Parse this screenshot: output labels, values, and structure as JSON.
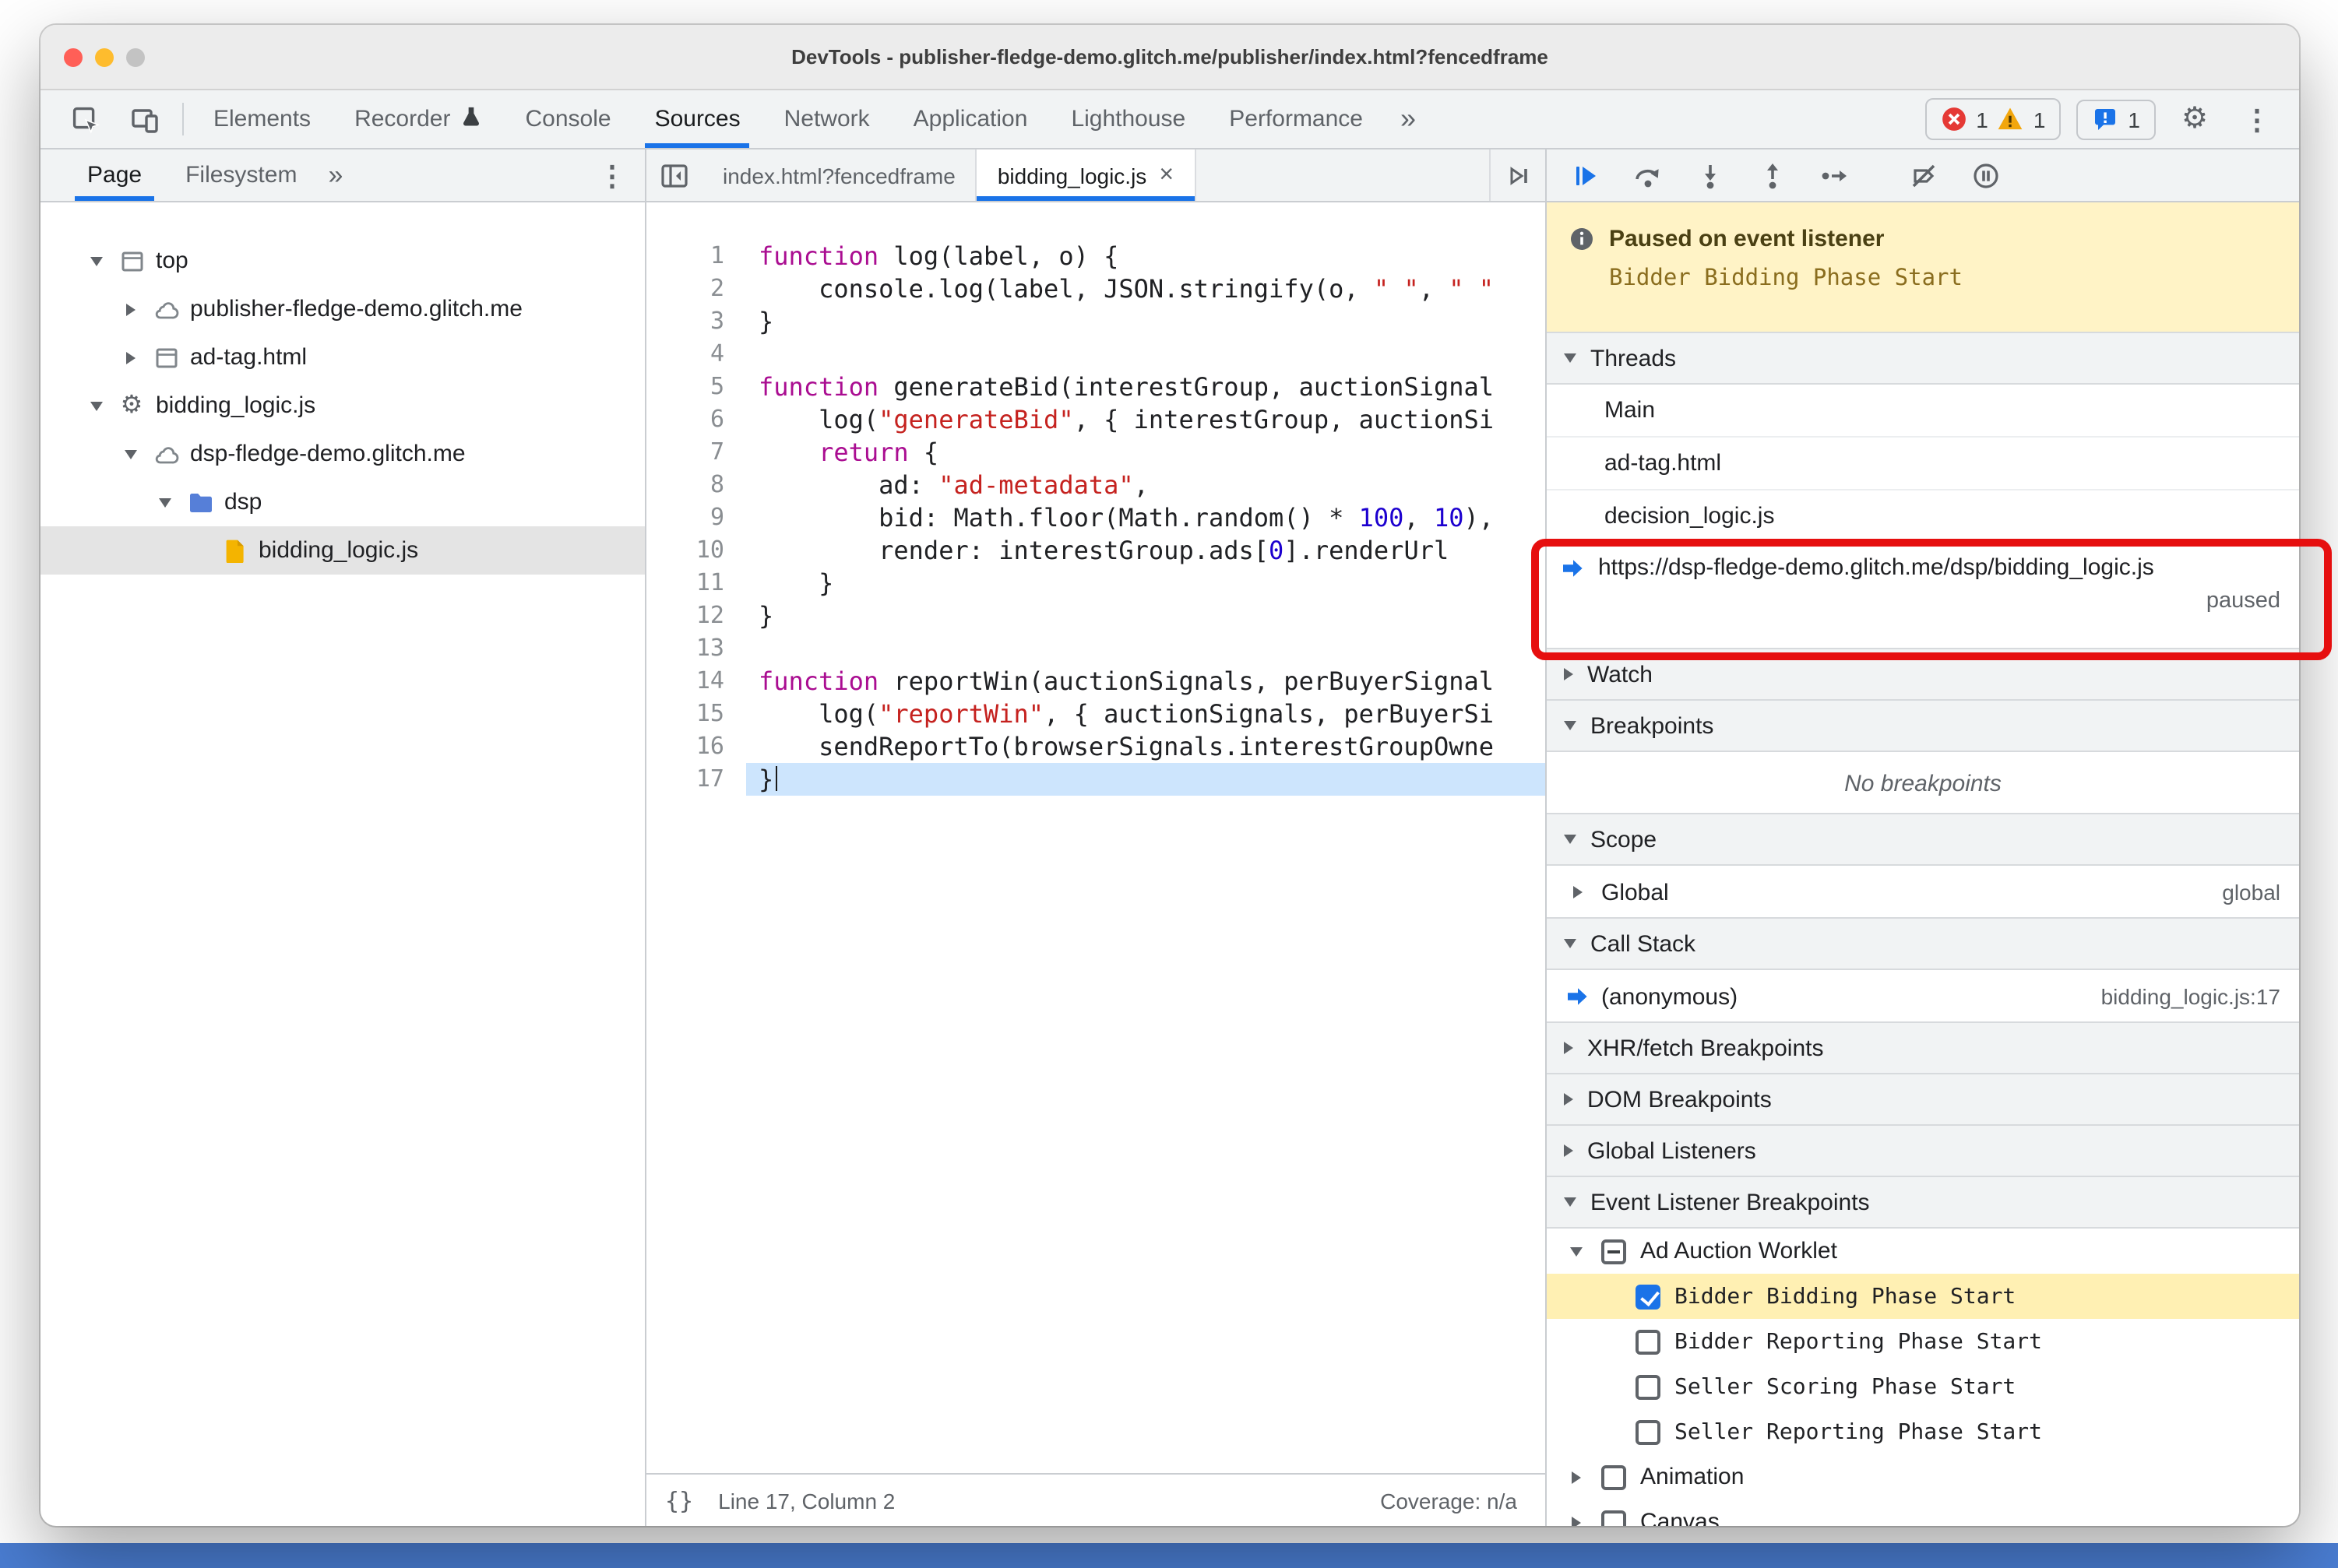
{
  "window": {
    "title": "DevTools - publisher-fledge-demo.glitch.me/publisher/index.html?fencedframe"
  },
  "toolbar": {
    "tabs": [
      {
        "label": "Elements"
      },
      {
        "label": "Recorder",
        "badge_icon": "flask"
      },
      {
        "label": "Console"
      },
      {
        "label": "Sources",
        "active": true
      },
      {
        "label": "Network"
      },
      {
        "label": "Application"
      },
      {
        "label": "Lighthouse"
      },
      {
        "label": "Performance"
      }
    ],
    "more_label": "»",
    "error_count": "1",
    "warning_count": "1",
    "issues_count": "1"
  },
  "sidebar": {
    "tabs": [
      {
        "label": "Page",
        "active": true
      },
      {
        "label": "Filesystem"
      }
    ],
    "more_label": "»",
    "tree": [
      {
        "label": "top",
        "icon": "frame-icon",
        "expander": "open",
        "indent": 0
      },
      {
        "label": "publisher-fledge-demo.glitch.me",
        "icon": "cloud-icon",
        "expander": "closed",
        "indent": 1
      },
      {
        "label": "ad-tag.html",
        "icon": "frame-icon",
        "expander": "closed",
        "indent": 1
      },
      {
        "label": "bidding_logic.js",
        "icon": "gear-icon",
        "expander": "open",
        "indent": 0
      },
      {
        "label": "dsp-fledge-demo.glitch.me",
        "icon": "cloud-icon",
        "expander": "open",
        "indent": 1
      },
      {
        "label": "dsp",
        "icon": "folder-icon",
        "expander": "open",
        "indent": 2
      },
      {
        "label": "bidding_logic.js",
        "icon": "js-file-icon",
        "expander": "none",
        "indent": 3,
        "selected": true
      }
    ]
  },
  "editor": {
    "tabs": [
      {
        "label": "index.html?fencedframe"
      },
      {
        "label": "bidding_logic.js",
        "active": true,
        "closable": true
      }
    ],
    "lines": [
      {
        "n": 1,
        "tokens": [
          [
            "kw",
            "function"
          ],
          [
            "pl",
            " log(label, o) {"
          ]
        ]
      },
      {
        "n": 2,
        "tokens": [
          [
            "pl",
            "    console.log(label, JSON.stringify(o, "
          ],
          [
            "str",
            "\" \""
          ],
          [
            "pl",
            ", "
          ],
          [
            "str",
            "\" \""
          ]
        ]
      },
      {
        "n": 3,
        "tokens": [
          [
            "pl",
            "}"
          ]
        ]
      },
      {
        "n": 4,
        "tokens": []
      },
      {
        "n": 5,
        "tokens": [
          [
            "kw",
            "function"
          ],
          [
            "pl",
            " generateBid(interestGroup, auctionSignal"
          ]
        ]
      },
      {
        "n": 6,
        "tokens": [
          [
            "pl",
            "    log("
          ],
          [
            "str",
            "\"generateBid\""
          ],
          [
            "pl",
            ", { interestGroup, auctionSi"
          ]
        ]
      },
      {
        "n": 7,
        "tokens": [
          [
            "pl",
            "    "
          ],
          [
            "kw",
            "return"
          ],
          [
            "pl",
            " {"
          ]
        ]
      },
      {
        "n": 8,
        "tokens": [
          [
            "pl",
            "        ad: "
          ],
          [
            "str",
            "\"ad-metadata\""
          ],
          [
            "pl",
            ","
          ]
        ]
      },
      {
        "n": 9,
        "tokens": [
          [
            "pl",
            "        bid: Math.floor(Math.random() * "
          ],
          [
            "num",
            "100"
          ],
          [
            "pl",
            ", "
          ],
          [
            "num",
            "10"
          ],
          [
            "pl",
            "),"
          ]
        ]
      },
      {
        "n": 10,
        "tokens": [
          [
            "pl",
            "        render: interestGroup.ads["
          ],
          [
            "num",
            "0"
          ],
          [
            "pl",
            "].renderUrl"
          ]
        ]
      },
      {
        "n": 11,
        "tokens": [
          [
            "pl",
            "    }"
          ]
        ]
      },
      {
        "n": 12,
        "tokens": [
          [
            "pl",
            "}"
          ]
        ]
      },
      {
        "n": 13,
        "tokens": []
      },
      {
        "n": 14,
        "tokens": [
          [
            "kw",
            "function"
          ],
          [
            "pl",
            " reportWin(auctionSignals, perBuyerSignal"
          ]
        ]
      },
      {
        "n": 15,
        "tokens": [
          [
            "pl",
            "    log("
          ],
          [
            "str",
            "\"reportWin\""
          ],
          [
            "pl",
            ", { auctionSignals, perBuyerSi"
          ]
        ]
      },
      {
        "n": 16,
        "tokens": [
          [
            "pl",
            "    sendReportTo(browserSignals.interestGroupOwne"
          ]
        ]
      },
      {
        "n": 17,
        "tokens": [
          [
            "pl",
            "}"
          ]
        ],
        "exec": true
      }
    ],
    "status": {
      "format_label": "{}",
      "line_col": "Line 17, Column 2",
      "coverage": "Coverage: n/a"
    }
  },
  "debugger": {
    "paused_message": {
      "title": "Paused on event listener",
      "detail": "Bidder Bidding Phase Start"
    },
    "sections": {
      "threads": {
        "title": "Threads",
        "items": [
          {
            "label": "Main"
          },
          {
            "label": "ad-tag.html"
          },
          {
            "label": "decision_logic.js"
          },
          {
            "label": "https://dsp-fledge-demo.glitch.me/dsp/bidding_logic.js",
            "active": true,
            "status": "paused"
          }
        ]
      },
      "watch": {
        "title": "Watch"
      },
      "breakpoints": {
        "title": "Breakpoints",
        "empty_message": "No breakpoints"
      },
      "scope": {
        "title": "Scope",
        "rows": [
          {
            "label": "Global",
            "detail": "global"
          }
        ]
      },
      "call_stack": {
        "title": "Call Stack",
        "frames": [
          {
            "label": "(anonymous)",
            "location": "bidding_logic.js:17"
          }
        ]
      },
      "xhr_breakpoints": {
        "title": "XHR/fetch Breakpoints"
      },
      "dom_breakpoints": {
        "title": "DOM Breakpoints"
      },
      "global_listeners": {
        "title": "Global Listeners"
      },
      "event_listener_breakpoints": {
        "title": "Event Listener Breakpoints",
        "groups": [
          {
            "label": "Ad Auction Worklet",
            "checkbox": "indeterminate",
            "expanded": true,
            "children": [
              {
                "label": "Bidder Bidding Phase Start",
                "checkbox": "checked",
                "highlighted": true
              },
              {
                "label": "Bidder Reporting Phase Start",
                "checkbox": "unchecked"
              },
              {
                "label": "Seller Scoring Phase Start",
                "checkbox": "unchecked"
              },
              {
                "label": "Seller Reporting Phase Start",
                "checkbox": "unchecked"
              }
            ]
          },
          {
            "label": "Animation",
            "checkbox": "unchecked",
            "expanded": false,
            "children": []
          },
          {
            "label": "Canvas",
            "checkbox": "unchecked",
            "expanded": false,
            "children": []
          }
        ]
      }
    }
  },
  "annotation": {
    "color": "#e60f0f"
  }
}
